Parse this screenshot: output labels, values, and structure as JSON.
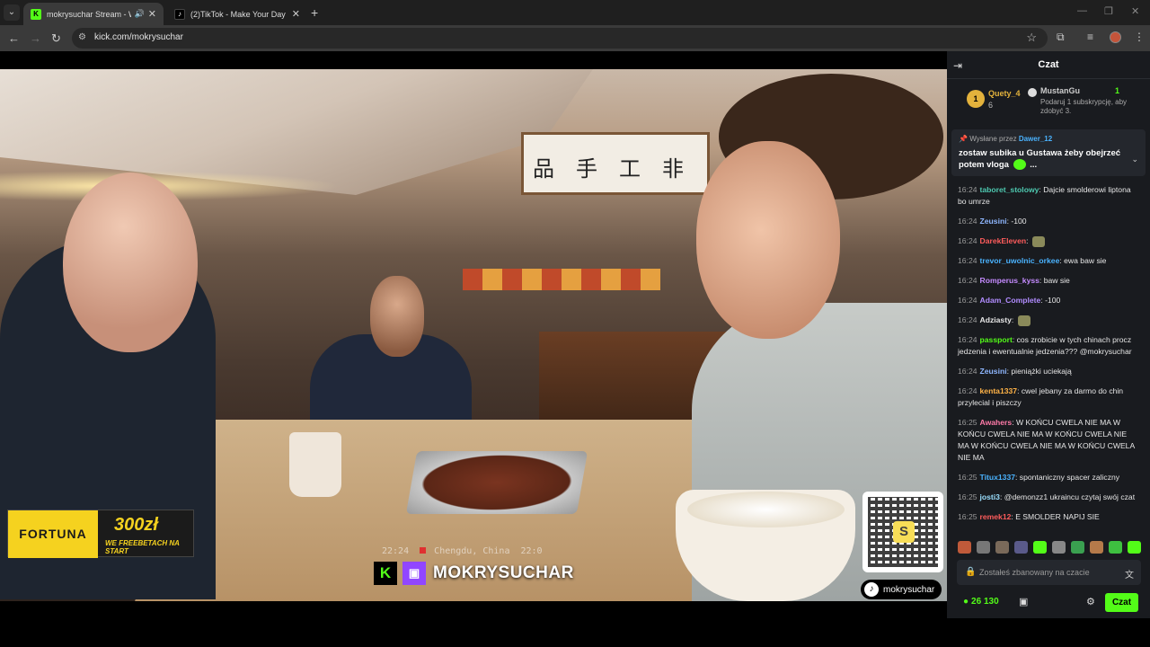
{
  "browser": {
    "tabs": [
      {
        "title": "mokrysuchar Stream - Watc",
        "favicon": "kick-logo-icon",
        "active": true
      },
      {
        "title": "(2)TikTok - Make Your Day",
        "favicon": "tiktok-logo-icon",
        "active": false
      }
    ],
    "new_tab": "+",
    "url": "kick.com/mokrysuchar"
  },
  "video": {
    "overlay_time": "22:24",
    "overlay_location": "Chengdu, China",
    "overlay_extra": "22:0",
    "streamer_name": "MOKRYSUCHAR",
    "tiktok_handle": "mokrysuchar",
    "qr_letter": "S",
    "ad": {
      "brand": "FORTUNA",
      "amount": "300zł",
      "tagline": "WE FREEBETACH NA START"
    }
  },
  "chat": {
    "title": "Czat",
    "leaderboard": [
      {
        "rank": "1",
        "name": "Quety_4",
        "count": "6"
      },
      {
        "name": "MustanGu",
        "count": "1",
        "note": "Podaruj 1 subskrypcję, aby zdobyć 3."
      }
    ],
    "pinned": {
      "prefix": "Wysłane przez",
      "user": "Dawer_12",
      "text": "zostaw subika u Gustawa żeby obejrzeć potem vloga",
      "suffix": "..."
    },
    "messages": [
      {
        "time": "16:24",
        "user": "taboret_stolowy",
        "color": "#4ec9b0",
        "text": "Dajcie smolderowi liptona bo umrze"
      },
      {
        "time": "16:24",
        "user": "Zeusini",
        "color": "#8fb7ff",
        "text": "-100"
      },
      {
        "time": "16:24",
        "user": "DarekEleven",
        "color": "#ff5c5c",
        "text": ""
      },
      {
        "time": "16:24",
        "user": "trevor_uwolnic_orkee",
        "color": "#4ab3ff",
        "text": "ewa baw sie"
      },
      {
        "time": "16:24",
        "user": "Romperus_kyss",
        "color": "#c58bff",
        "text": "baw sie"
      },
      {
        "time": "16:24",
        "user": "Adam_Complete",
        "color": "#b18cff",
        "text": "-100"
      },
      {
        "time": "16:24",
        "user": "Adziasty",
        "color": "#e6e6e6",
        "text": ""
      },
      {
        "time": "16:24",
        "user": "passport",
        "color": "#53fc18",
        "text": "cos zrobicie w tych chinach procz jedzenia i ewentualnie jedzenia??? @mokrysuchar"
      },
      {
        "time": "16:24",
        "user": "Zeusini",
        "color": "#8fb7ff",
        "text": "pieniążki uciekają"
      },
      {
        "time": "16:24",
        "user": "kenta1337",
        "color": "#ffb347",
        "text": "cwel jebany za darmo do chin przylecial i piszczy"
      },
      {
        "time": "16:25",
        "user": "Awahers",
        "color": "#ff7aa8",
        "text": "W KOŃCU CWELA NIE MA W KOŃCU CWELA NIE MA W KOŃCU CWELA NIE MA W KOŃCU CWELA NIE MA W KOŃCU CWELA NIE MA"
      },
      {
        "time": "16:25",
        "user": "Titux1337",
        "color": "#4ab3ff",
        "text": "spontaniczny spacer zaliczny"
      },
      {
        "time": "16:25",
        "user": "josti3",
        "color": "#9adfff",
        "text": "@demonzz1 ukraincu czytaj swój czat"
      },
      {
        "time": "16:25",
        "user": "remek12",
        "color": "#ff5c5c",
        "text": "E SMOLDER NAPIJ SIE"
      }
    ],
    "input_placeholder": "Zostałeś zbanowany na czacie",
    "points": "26 130",
    "send_label": "Czat"
  },
  "colors": {
    "kick_green": "#53fc18",
    "chat_bg": "#191b1f",
    "twitch_purple": "#9146ff",
    "fortuna_yellow": "#f5d21f"
  }
}
